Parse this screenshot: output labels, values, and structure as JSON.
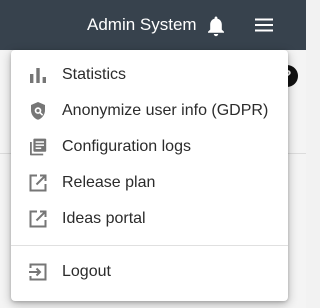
{
  "header": {
    "title": "Admin System",
    "notifications_icon": "bell-icon",
    "menu_icon": "hamburger-menu-icon",
    "background_color": "#37424d"
  },
  "help": {
    "label": "?"
  },
  "menu": {
    "items": [
      {
        "label": "Statistics",
        "icon": "bar-chart-icon"
      },
      {
        "label": "Anonymize user info (GDPR)",
        "icon": "shield-user-icon"
      },
      {
        "label": "Configuration logs",
        "icon": "library-books-icon"
      },
      {
        "label": "Release plan",
        "icon": "open-in-new-icon"
      },
      {
        "label": "Ideas portal",
        "icon": "open-in-new-icon"
      }
    ],
    "logout": {
      "label": "Logout",
      "icon": "logout-icon"
    }
  },
  "colors": {
    "icon": "#767676",
    "text": "#2b2b2b"
  }
}
